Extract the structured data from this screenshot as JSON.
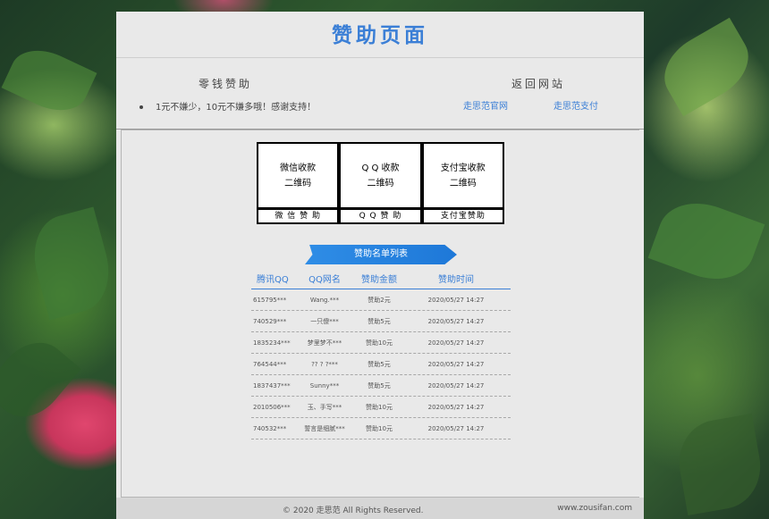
{
  "page": {
    "title": "赞助页面"
  },
  "top": {
    "left_heading": "零钱赞助",
    "bullet_text": "1元不嫌少，10元不嫌多哦！感谢支持！",
    "right_heading": "返回网站",
    "links": [
      "走思范官网",
      "走思范支付"
    ]
  },
  "qr": [
    {
      "image_line1": "微信收款",
      "image_line2": "二维码",
      "label": "微 信 赞 助"
    },
    {
      "image_line1": "Q Q 收款",
      "image_line2": "二维码",
      "label": "Q Q 赞 助"
    },
    {
      "image_line1": "支付宝收款",
      "image_line2": "二维码",
      "label": "支付宝赞助"
    }
  ],
  "list": {
    "ribbon": "赞助名单列表",
    "headers": [
      "腾讯QQ",
      "QQ网名",
      "赞助金额",
      "赞助时间"
    ],
    "rows": [
      {
        "qq": "615795***",
        "name": "Wang.***",
        "amount": "赞助2元",
        "time": "2020/05/27 14:27"
      },
      {
        "qq": "740529***",
        "name": "一只傻***",
        "amount": "赞助5元",
        "time": "2020/05/27 14:27"
      },
      {
        "qq": "1835234***",
        "name": "梦里梦不***",
        "amount": "赞助10元",
        "time": "2020/05/27 14:27"
      },
      {
        "qq": "764544***",
        "name": "?? ? ?***",
        "amount": "赞助5元",
        "time": "2020/05/27 14:27"
      },
      {
        "qq": "1837437***",
        "name": "Sunny***",
        "amount": "赞助5元",
        "time": "2020/05/27 14:27"
      },
      {
        "qq": "2010506***",
        "name": "玉、手写***",
        "amount": "赞助10元",
        "time": "2020/05/27 14:27"
      },
      {
        "qq": "740532***",
        "name": "誓言是细腻***",
        "amount": "赞助10元",
        "time": "2020/05/27 14:27"
      }
    ]
  },
  "footer": {
    "copyright": "© 2020 走思范 All Rights Reserved.",
    "domain": "www.zousifan.com"
  },
  "colors": {
    "accent": "#3b7fd6",
    "ribbon": "#1e78d8",
    "panel": "#e9e9e9"
  }
}
